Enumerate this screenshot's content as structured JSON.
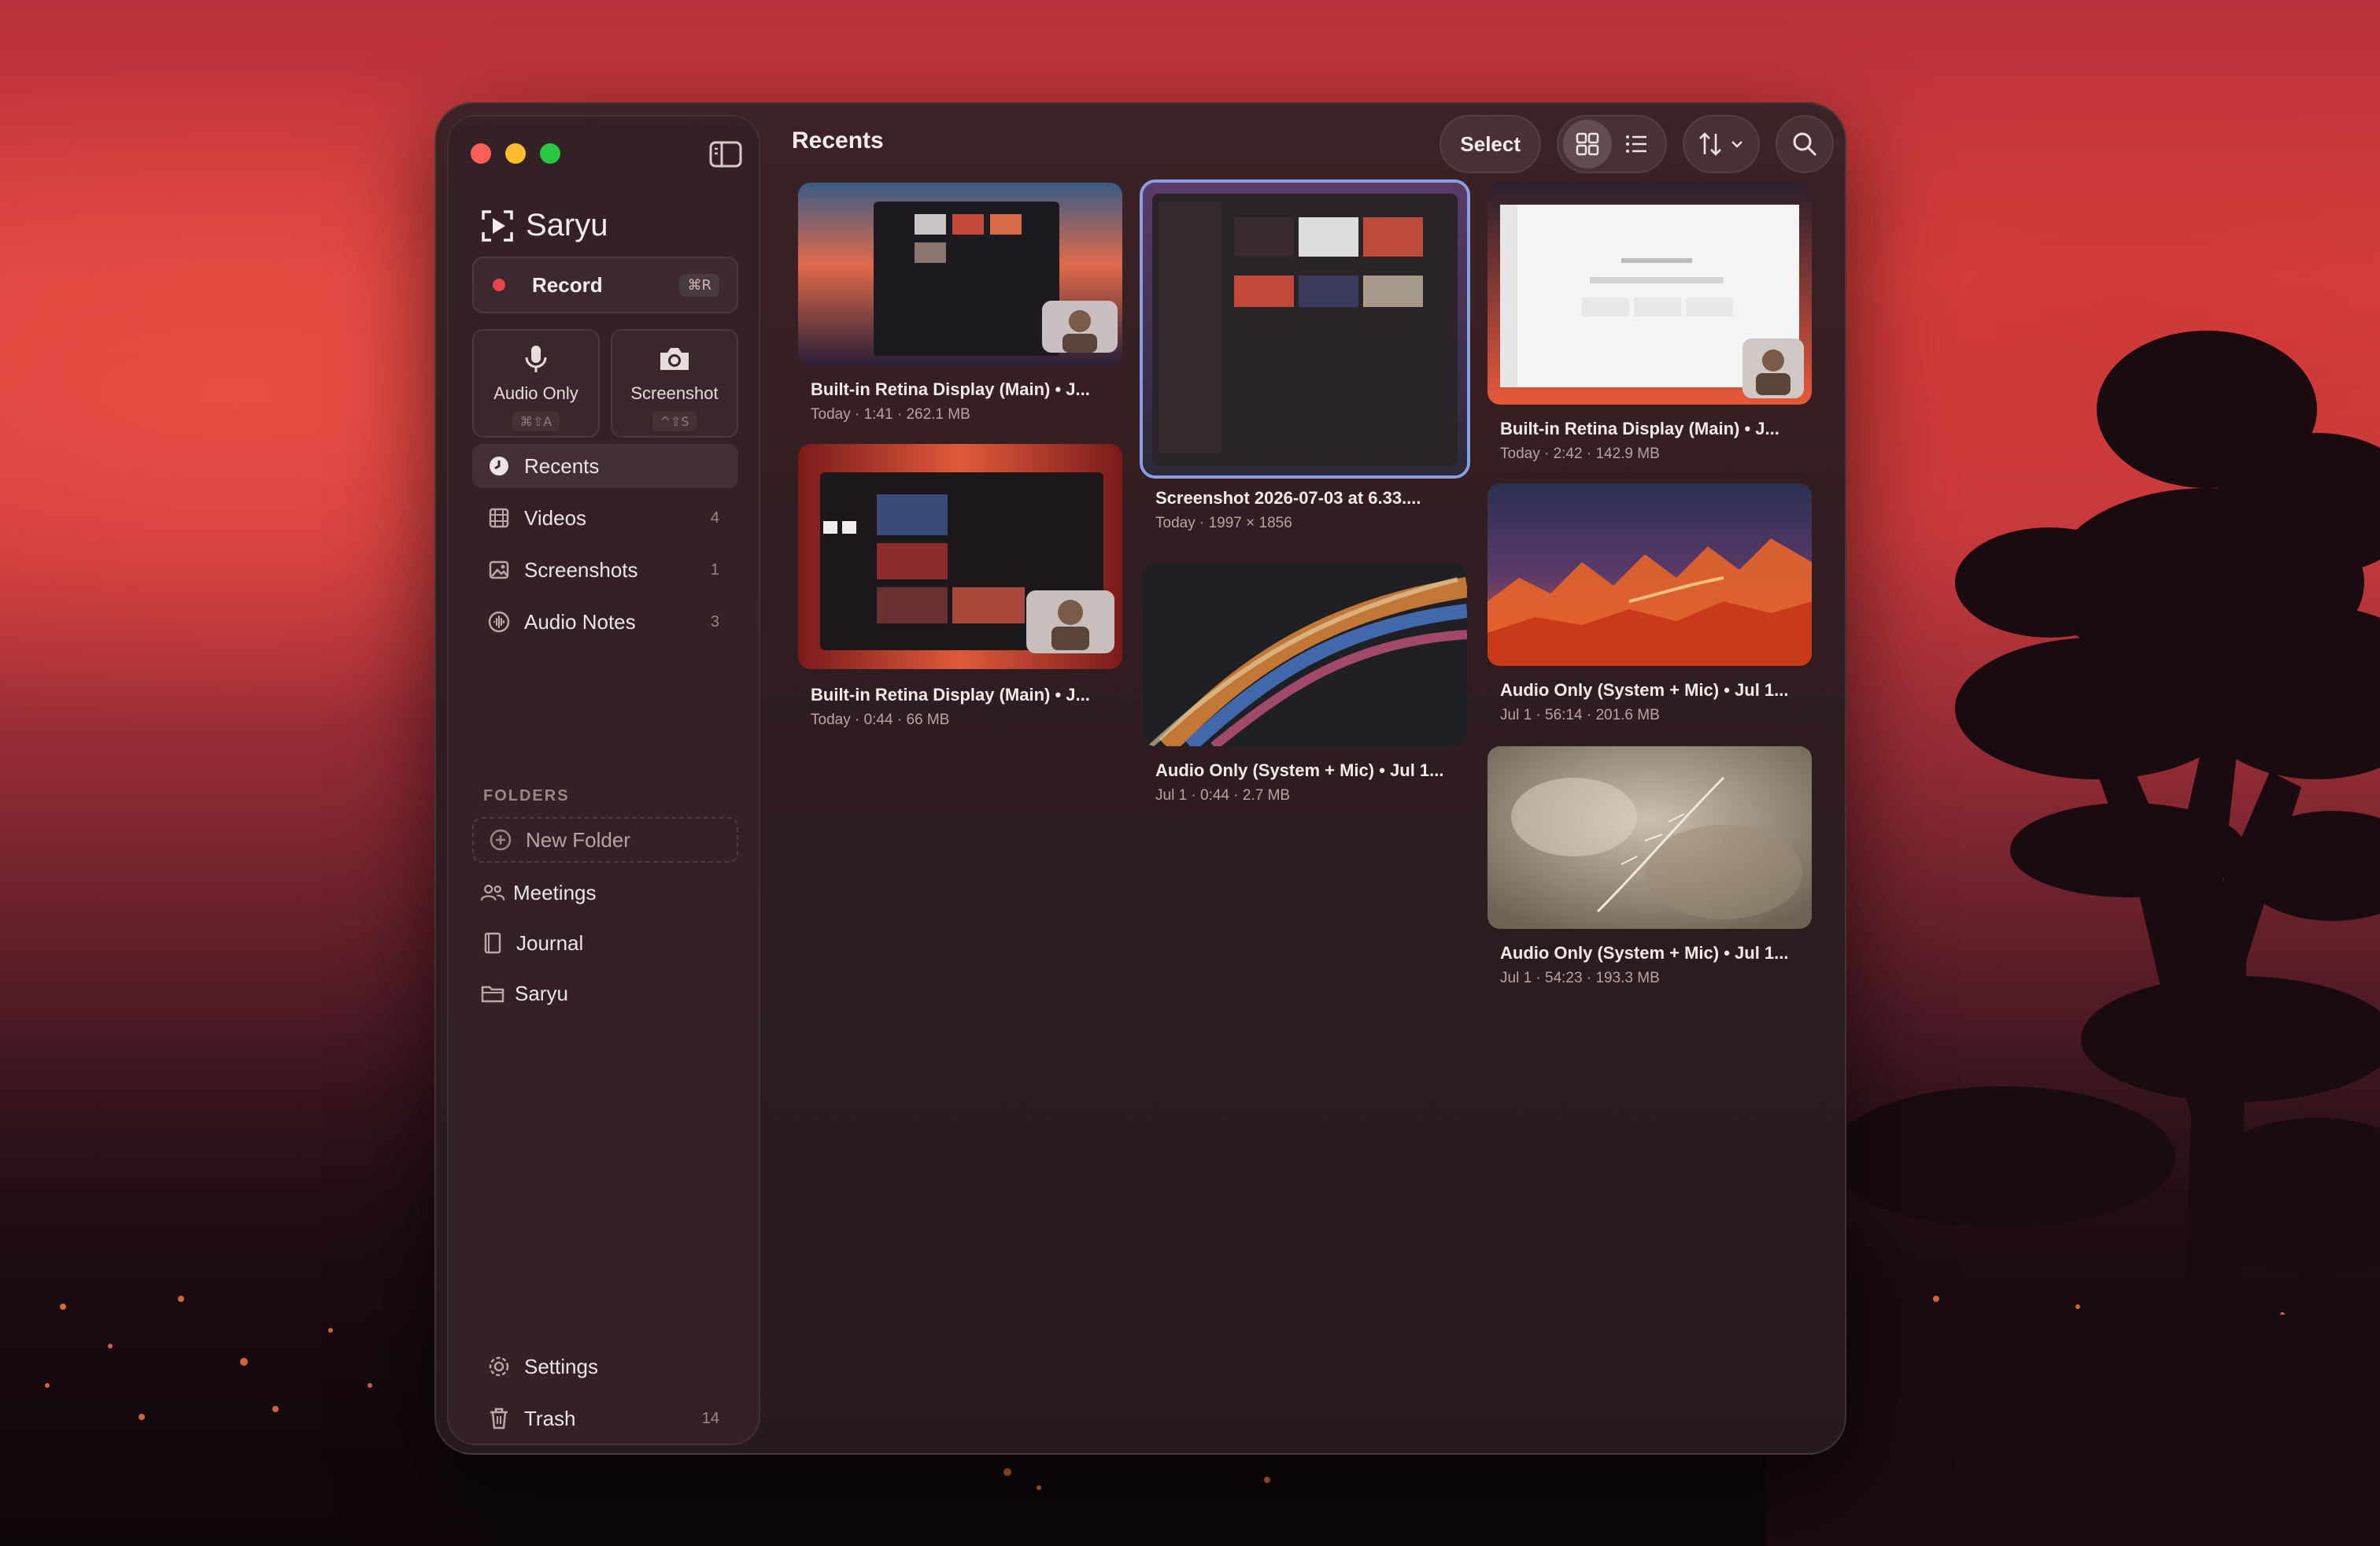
{
  "app": {
    "name": "Saryu",
    "page_title": "Recents"
  },
  "sidebar": {
    "record": {
      "label": "Record",
      "shortcut": "⌘R"
    },
    "quick_actions": [
      {
        "label": "Audio Only",
        "shortcut": "⌘⇧A",
        "icon": "microphone-icon"
      },
      {
        "label": "Screenshot",
        "shortcut": "^⇧S",
        "icon": "camera-icon"
      }
    ],
    "library": [
      {
        "label": "Recents",
        "count": "",
        "icon": "clock-icon",
        "active": true
      },
      {
        "label": "Videos",
        "count": "4",
        "icon": "film-icon",
        "active": false
      },
      {
        "label": "Screenshots",
        "count": "1",
        "icon": "image-icon",
        "active": false
      },
      {
        "label": "Audio Notes",
        "count": "3",
        "icon": "waveform-icon",
        "active": false
      }
    ],
    "folders_heading": "FOLDERS",
    "new_folder": "New Folder",
    "folders": [
      {
        "label": "Meetings",
        "icon": "people-icon"
      },
      {
        "label": "Journal",
        "icon": "book-icon"
      },
      {
        "label": "Saryu",
        "icon": "folder-icon"
      }
    ],
    "footer": [
      {
        "label": "Settings",
        "count": "",
        "icon": "gear-icon"
      },
      {
        "label": "Trash",
        "count": "14",
        "icon": "trash-icon"
      }
    ]
  },
  "toolbar": {
    "select_label": "Select",
    "view_mode": "grid",
    "icons": [
      "grid-view-icon",
      "list-view-icon",
      "sort-icon",
      "search-icon"
    ]
  },
  "items": [
    {
      "title": "Built-in Retina Display (Main) • J...",
      "meta": "Today · 1:41 · 262.1 MB"
    },
    {
      "title": "Built-in Retina Display (Main) • J...",
      "meta": "Today · 0:44 · 66 MB"
    },
    {
      "title": "Screenshot 2026-07-03 at 6.33....",
      "meta": "Today · 1997 × 1856"
    },
    {
      "title": "Audio Only (System + Mic) • Jul 1...",
      "meta": "Jul 1 · 0:44 · 2.7 MB"
    },
    {
      "title": "Built-in Retina Display (Main) • J...",
      "meta": "Today · 2:42 · 142.9 MB"
    },
    {
      "title": "Audio Only (System + Mic) • Jul 1...",
      "meta": "Jul 1 · 56:14 · 201.6 MB"
    },
    {
      "title": "Audio Only (System + Mic) • Jul 1...",
      "meta": "Jul 1 · 54:23 · 193.3 MB"
    }
  ],
  "colors": {
    "accent_selected": "#8b9fe0",
    "record_dot": "#e8424a",
    "window_bg": "#2f1d21"
  }
}
